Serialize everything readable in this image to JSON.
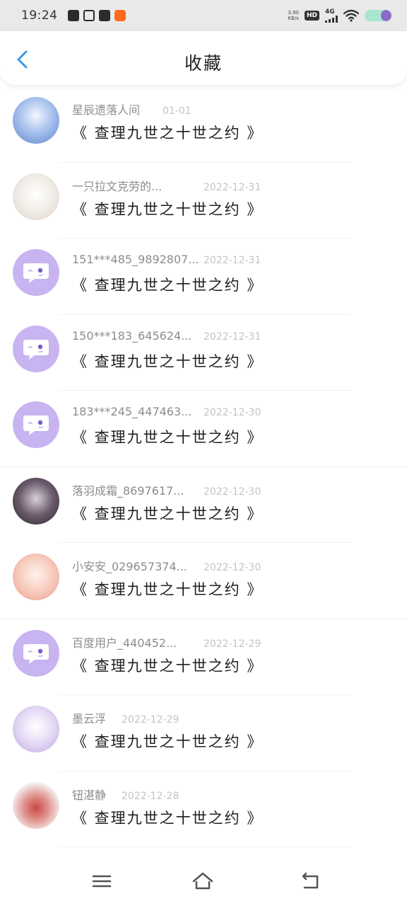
{
  "status_bar": {
    "time": "19:24",
    "net_speed_value": "3.90",
    "net_speed_unit": "KB/s",
    "hd_label": "HD",
    "signal_label": "4G",
    "battery_level": 0.4,
    "icons": [
      "mail-icon",
      "app-icon",
      "book-icon",
      "pumpkin-app-icon",
      "wifi-icon",
      "battery-icon"
    ]
  },
  "header": {
    "title": "收藏",
    "back_icon": "chevron-left-icon",
    "accent_color": "#3a97e8"
  },
  "favorites": [
    {
      "user": "星辰遗落人间",
      "date": "01-01",
      "title": "《 查理九世之十世之约 》",
      "avatar": "anime-photo-blue"
    },
    {
      "user": "一只拉文克劳的...",
      "date": "2022-12-31",
      "title": "《 查理九世之十世之约 》",
      "avatar": "anime-photo-white"
    },
    {
      "user": "151***485_9892807...",
      "date": "2022-12-31",
      "title": "《 查理九世之十世之约 》",
      "avatar": "default-chat-avatar"
    },
    {
      "user": "150***183_645624...",
      "date": "2022-12-31",
      "title": "《 查理九世之十世之约 》",
      "avatar": "default-chat-avatar"
    },
    {
      "user": "183***245_447463...",
      "date": "2022-12-30",
      "title": "《 查理九世之十世之约 》",
      "avatar": "default-chat-avatar"
    },
    {
      "user": "落羽成霜_8697617...",
      "date": "2022-12-30",
      "title": "《 查理九世之十世之约 》",
      "avatar": "anime-photo-dark"
    },
    {
      "user": "小安安_029657374...",
      "date": "2022-12-30",
      "title": "《 查理九世之十世之约 》",
      "avatar": "anime-photo-pink"
    },
    {
      "user": "百度用户_440452...",
      "date": "2022-12-29",
      "title": "《 查理九世之十世之约 》",
      "avatar": "default-chat-avatar"
    },
    {
      "user": "墨云浮",
      "date": "2022-12-29",
      "title": "《 查理九世之十世之约 》",
      "avatar": "anime-photo-lavender"
    },
    {
      "user": "钮湛静",
      "date": "2022-12-28",
      "title": "《 查理九世之十世之约 》",
      "avatar": "cartoon-photo-red"
    }
  ],
  "nav": {
    "icons": [
      "menu-icon",
      "home-icon",
      "back-icon"
    ]
  },
  "colors": {
    "default_avatar_bg": "#c8b4f0",
    "default_avatar_eye": "#7d5cc7"
  }
}
